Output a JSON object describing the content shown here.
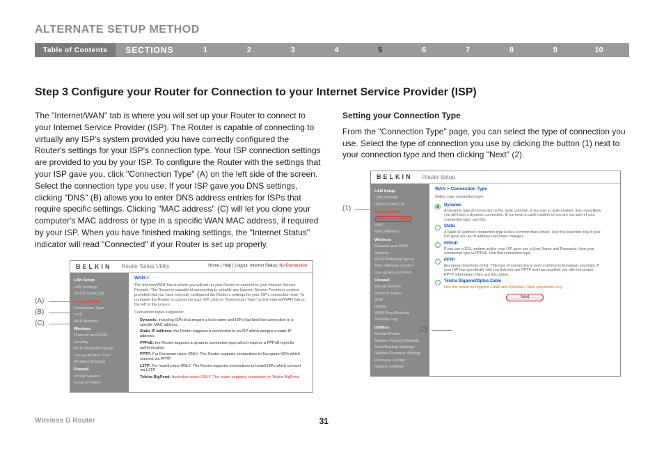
{
  "header": {
    "section_title": "ALTERNATE SETUP METHOD"
  },
  "nav": {
    "toc": "Table of Contents",
    "sections": "SECTIONS",
    "items": [
      "1",
      "2",
      "3",
      "4",
      "5",
      "6",
      "7",
      "8",
      "9",
      "10"
    ],
    "active_index": 4
  },
  "step": {
    "heading": "Step 3 Configure your Router for Connection to your Internet Service Provider (ISP)"
  },
  "left": {
    "para": "The \"Internet/WAN\" tab is where you will set up your Router to connect to your Internet Service Provider (ISP). The Router is capable of connecting to virtually any ISP's system provided you have correctly configured the Router's settings for your ISP's connection type. Your ISP connection settings are provided to you by your ISP. To configure the Router with the settings that your ISP gave you, click \"Connection Type\" (A) on the left side of the screen. Select the connection type you use. If your ISP gave you DNS settings, clicking \"DNS\" (B) allows you to enter DNS address entries for ISPs that require specific settings. Clicking \"MAC address\" (C) will let you clone your computer's MAC address or type in a specific WAN MAC address, if required by your ISP. When you have finished making settings, the \"Internet Status\" indicator will read \"Connected\" if your Router is set up properly.",
    "callouts": {
      "a": "(A)",
      "b": "(B)",
      "c": "(C)"
    }
  },
  "right": {
    "sub_heading": "Setting your Connection Type",
    "para": "From the \"Connection Type\" page, you can select the type of connection you use. Select the type of connection you use by clicking the button (1) next to your connection type and then clicking \"Next\" (2).",
    "callouts": {
      "one": "(1)",
      "two": "(2)"
    }
  },
  "shot1": {
    "brand": "BELKIN",
    "title": "Router Setup Utility",
    "links_left": "Home | Help | Logout",
    "status_label": "Internet Status:",
    "status_value": "No Connection",
    "crumb": "WAN >",
    "desc": "The Internet/WAN Tab is where you will set up your Router to connect to your Internet Service Provider. The Router is capable of connecting to virtually any Internet Service Provider's system provided that you have correctly configured the Router's settings for your ISP's connection type. To configure the Router to connect to your ISP, click on \"Connection Type\" on the Internet/WAN Tab on the left of the screen.",
    "sub": "Connection types supported:",
    "bullets": [
      {
        "name": "Dynamic:",
        "text": "including ISPs that require a host name and ISPs that bind the connection to a specific MAC address."
      },
      {
        "name": "Static IP address:",
        "text": "the Router supports a connection to an ISP which assigns a static IP address."
      },
      {
        "name": "PPPoE:",
        "text": "the Router supports a dynamic connection type which requires a PPPoE login for authentication."
      },
      {
        "name": "PPTP:",
        "text": "For European users ONLY. The Router supports connections to European ISPs which connect via PPTP."
      },
      {
        "name": "L2TP:",
        "text": "For Israeli users ONLY. The Router supports connections to Israeli ISPs which connect via L2TP."
      },
      {
        "name": "Telstra BigPond:",
        "text": "Australian users ONLY. The router supports connection to Telstra BigPond.",
        "red": true
      }
    ],
    "sidebar": {
      "groups": [
        {
          "title": "LAN Setup",
          "items": [
            "LAN Settings",
            "DHCP Client List"
          ]
        },
        {
          "title": "Internet WAN",
          "hl": true,
          "items": [
            "Connection Type",
            "DNS",
            "MAC Address"
          ]
        },
        {
          "title": "Wireless",
          "items": [
            "Channel and SSID",
            "Security",
            "Wi-Fi Protected Setup",
            "Use as Access Point",
            "Wireless Bridging"
          ]
        },
        {
          "title": "Firewall",
          "items": [
            "Virtual Servers",
            "Client IP Filters"
          ]
        }
      ]
    }
  },
  "shot2": {
    "brand": "BELKIN",
    "title": "Router Setup",
    "crumb": "WAN > Connection Type",
    "lead": "Select your connection type:",
    "options": [
      {
        "name": "Dynamic",
        "sel": true,
        "desc": "A Dynamic type of connection is the most common. If you use a cable modem, then most likely you will have a dynamic connection. If you have a cable modem or you are not sure of your connection type, use this."
      },
      {
        "name": "Static",
        "desc": "A Static IP address connection type is less common than others. Use this selection only if your ISP gave you an IP address that never changes."
      },
      {
        "name": "PPPoE",
        "desc": "If you use a DSL modem and/or your ISP gave you a User Name and Password, then your connection type is PPPoE. Use this connection type."
      },
      {
        "name": "PPTP",
        "desc": "[European Countries Only]. This type of connection is most common in European countries. If your ISP has specifically told you that you use PPTP and has supplied you with the proper PPTP information, then use this option."
      },
      {
        "name": "Telstra Bigpond/Optus Cable",
        "desc": "Use this option for Bigpond Cable and OptusNet Cable connection only.",
        "orange": true
      }
    ],
    "next": "Next",
    "sidebar": {
      "groups": [
        {
          "title": "LAN Setup",
          "items": [
            "LAN Settings",
            "DHCP Client List"
          ]
        },
        {
          "title": "Internet WAN",
          "hl": true,
          "items_hl": "Connection Type",
          "items": [
            "DNS",
            "MAC Address"
          ]
        },
        {
          "title": "Wireless",
          "items": [
            "Channel and SSID",
            "Security",
            "Wi-Fi Protected Setup",
            "MAC Address Control",
            "Use as Access Point"
          ]
        },
        {
          "title": "Firewall",
          "items": [
            "Virtual Servers",
            "Client IP Filters",
            "DMZ",
            "DDNS",
            "WAN Ping Blocking",
            "Security Log"
          ]
        },
        {
          "title": "Utilities",
          "items": [
            "Restart Router",
            "Restore Factory Defaults",
            "Save/Backup Settings",
            "Restore Previous Settings",
            "Firmware Update",
            "System Settings"
          ]
        }
      ]
    }
  },
  "footer": {
    "product": "Wireless G Router",
    "page": "31"
  }
}
